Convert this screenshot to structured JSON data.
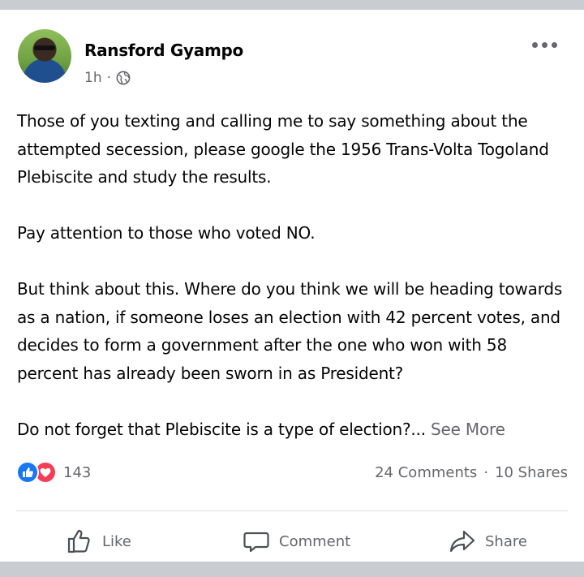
{
  "post": {
    "author": "Ransford Gyampo",
    "time": "1h",
    "separator": "·",
    "paragraphs": [
      "Those of you texting and calling me to say something about the attempted secession, please google the 1956 Trans-Volta Togoland Plebiscite and study the results.",
      "Pay attention to those who voted NO.",
      "But think about this. Where do you think we will be heading towards as a nation, if someone loses an election with 42 percent votes, and decides to form a government after the one who won with 58 percent has already been sworn in as President?"
    ],
    "last_paragraph": "Do not forget that Plebiscite is a type of election?...",
    "see_more": "See More"
  },
  "reactions": {
    "count": "143",
    "types": [
      "like-reaction",
      "love-reaction"
    ]
  },
  "engagement": {
    "comments": "24 Comments",
    "dot": "·",
    "shares": "10 Shares"
  },
  "actions": {
    "like": "Like",
    "comment": "Comment",
    "share": "Share"
  },
  "colors": {
    "like_blue": "#1877f2",
    "love_red": "#f33e58",
    "secondary_text": "#65676b"
  }
}
